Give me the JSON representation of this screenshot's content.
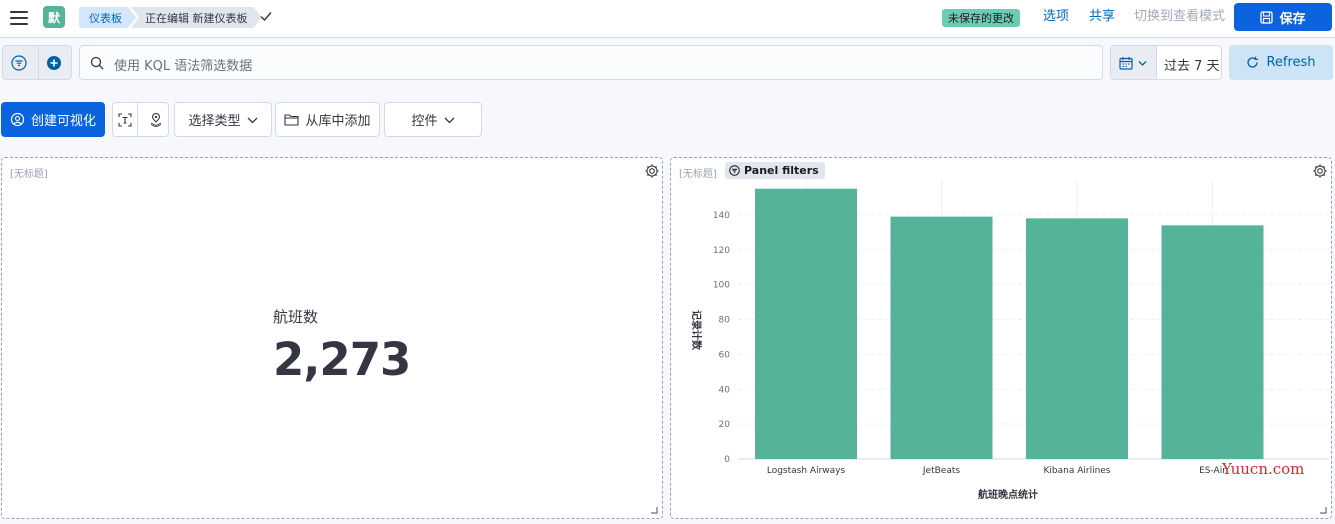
{
  "header": {
    "space_initial": "默",
    "breadcrumbs": [
      "仪表板",
      "正在编辑 新建仪表板"
    ],
    "unsaved_badge": "未保存的更改",
    "options_label": "选项",
    "share_label": "共享",
    "view_mode_label": "切换到查看模式",
    "save_label": "保存"
  },
  "query_bar": {
    "search_placeholder": "使用 KQL 语法筛选数据",
    "date_range": "过去 7 天",
    "refresh_label": "Refresh"
  },
  "toolbar": {
    "create_viz_label": "创建可视化",
    "select_type_label": "选择类型",
    "add_from_library_label": "从库中添加",
    "controls_label": "控件"
  },
  "panels": {
    "left": {
      "title": "[无标题]",
      "metric_label": "航班数",
      "metric_value": "2,273"
    },
    "right": {
      "title": "[无标题]",
      "filters_badge": "Panel filters"
    }
  },
  "watermark": "Yuucn.com",
  "colors": {
    "accent": "#0b64dd",
    "bar": "#54b399",
    "badge": "#6dccb1"
  },
  "chart_data": {
    "type": "bar",
    "categories": [
      "Logstash Airways",
      "JetBeats",
      "Kibana Airlines",
      "ES-Air"
    ],
    "values": [
      155,
      139,
      138,
      134
    ],
    "xlabel": "航班晚点统计",
    "ylabel": "记录计数",
    "yticks": [
      0,
      20,
      40,
      60,
      80,
      100,
      120,
      140
    ],
    "ylim": [
      0,
      160
    ],
    "grid": true
  }
}
